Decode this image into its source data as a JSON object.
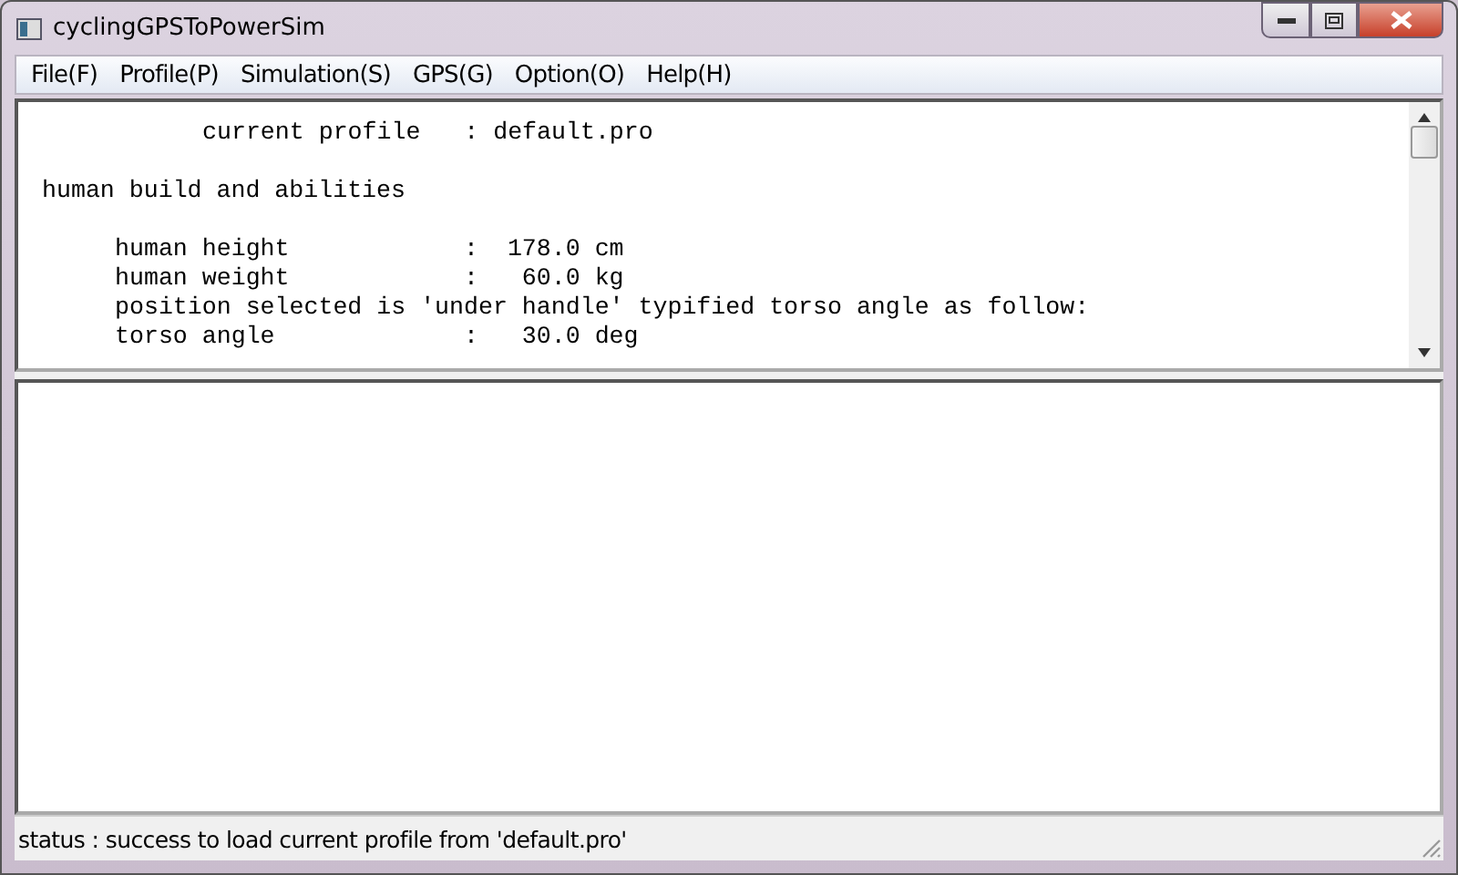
{
  "window": {
    "title": "cyclingGPSToPowerSim"
  },
  "menu": [
    "File(F)",
    "Profile(P)",
    "Simulation(S)",
    "GPS(G)",
    "Option(O)",
    "Help(H)"
  ],
  "profile_text": [
    {
      "kind": "title",
      "text": "current profile   : default.pro"
    },
    {
      "kind": "heading",
      "text": "human build and abilities"
    },
    {
      "kind": "item",
      "text": "human height            :  178.0 cm"
    },
    {
      "kind": "item",
      "text": "human weight            :   60.0 kg"
    },
    {
      "kind": "item",
      "text": "position selected is 'under handle' typified torso angle as follow:"
    },
    {
      "kind": "item",
      "text": "torso angle             :   30.0 deg"
    }
  ],
  "status_bar": "status : success to load current profile from 'default.pro'"
}
